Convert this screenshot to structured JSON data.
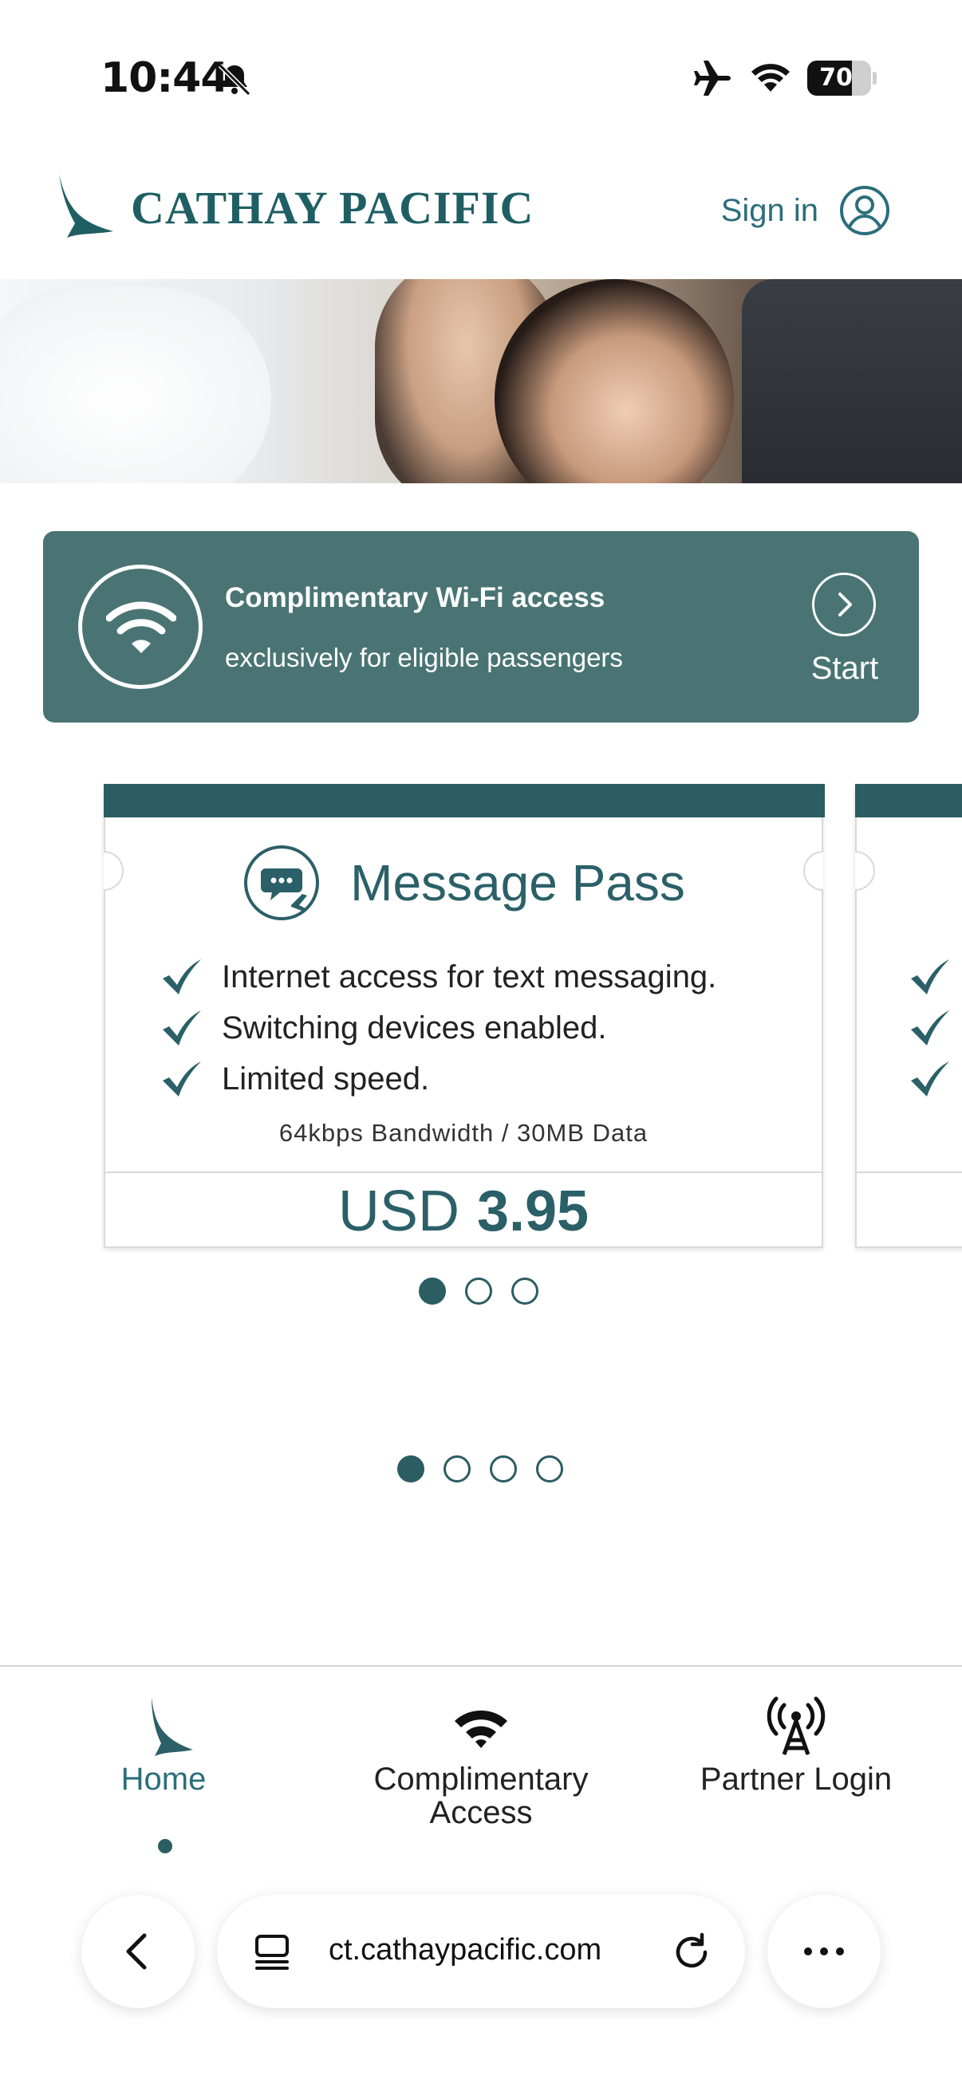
{
  "status_bar": {
    "time": "10:44",
    "battery": "70",
    "battery_level": 0.7
  },
  "header": {
    "logo_text": "CATHAY PACIFIC",
    "sign_in": "Sign in"
  },
  "wifi_banner": {
    "title": "Complimentary Wi-Fi access",
    "subtitle": "exclusively for eligible passengers",
    "action": "Start"
  },
  "pass": {
    "title": "Message Pass",
    "features": [
      "Internet access for text messaging.",
      "Switching devices enabled.",
      "Limited speed."
    ],
    "bandwidth": "64kbps Bandwidth / 30MB Data",
    "currency": "USD",
    "price": "3.95"
  },
  "carousel": {
    "inner_dots": 3,
    "inner_active": 0,
    "outer_dots": 4,
    "outer_active": 0
  },
  "bottom_nav": {
    "items": [
      {
        "label": "Home",
        "icon": "cathay-logo-icon",
        "active": true
      },
      {
        "label": "Complimentary\nAccess",
        "icon": "wifi-icon",
        "active": false
      },
      {
        "label": "Partner Login",
        "icon": "antenna-icon",
        "active": false
      }
    ]
  },
  "browser": {
    "url": "ct.cathaypacific.com"
  },
  "colors": {
    "brand_teal": "#2b5d62",
    "banner_teal": "#497473",
    "link_teal": "#2b6e7b"
  }
}
